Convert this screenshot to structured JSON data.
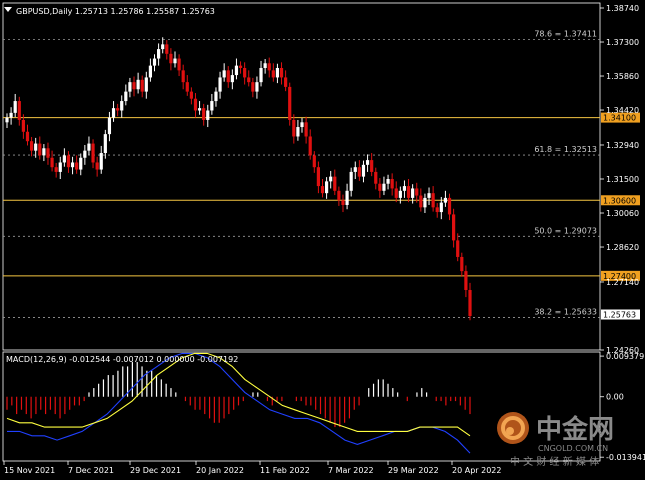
{
  "header": {
    "symbol_line": "GBPUSD,Daily  1.25713 1.25786 1.25587 1.25763",
    "dropdown_icon": "triangle-down-icon"
  },
  "indicator": {
    "label": "MACD(12,26,9) -0.012544 -0.007012 0.000000 -0.007192",
    "axis_ticks": [
      "0.009379",
      "0.00",
      "-0.013941"
    ]
  },
  "watermark": {
    "brand": "中金网",
    "domain": "CNGOLD.COM.CN",
    "tagline": "中 文 财 经 新 媒 体",
    "logo_icon": "cngold-logo-icon"
  },
  "colors": {
    "background": "#000000",
    "bull": "#ffffff",
    "bear": "#e01010",
    "level_line": "#f5c542",
    "fib_line": "#9a9a9a",
    "level_label_bg": "#f0a020",
    "current_label_bg": "#ffffff",
    "macd_main": "#2040ff",
    "macd_signal": "#ffff40"
  },
  "chart_data": {
    "type": "candlestick",
    "symbol": "GBPUSD",
    "timeframe": "Daily",
    "ohlc": {
      "open": 1.25713,
      "high": 1.25786,
      "low": 1.25587,
      "close": 1.25763
    },
    "ylim": [
      1.2426,
      1.3874
    ],
    "y_ticks": [
      "1.38740",
      "1.37300",
      "1.35860",
      "1.34420",
      "1.32940",
      "1.31500",
      "1.30060",
      "1.28620",
      "1.27140",
      "1.24260"
    ],
    "x_ticks": [
      "15 Nov 2021",
      "7 Dec 2021",
      "29 Dec 2021",
      "20 Jan 2022",
      "11 Feb 2022",
      "7 Mar 2022",
      "29 Mar 2022",
      "20 Apr 2022"
    ],
    "current_price": "1.25763",
    "levels": [
      {
        "value": 1.341,
        "label": "1.34100"
      },
      {
        "value": 1.306,
        "label": "1.30600"
      },
      {
        "value": 1.274,
        "label": "1.27400"
      }
    ],
    "fib_levels": [
      {
        "value": 1.37411,
        "label": "78.6 = 1.37411"
      },
      {
        "value": 1.32513,
        "label": "61.8 = 1.32513"
      },
      {
        "value": 1.29073,
        "label": "50.0 = 1.29073"
      },
      {
        "value": 1.25633,
        "label": "38.2 = 1.25633"
      }
    ],
    "closes": [
      1.341,
      1.343,
      1.348,
      1.34,
      1.335,
      1.331,
      1.327,
      1.33,
      1.325,
      1.328,
      1.324,
      1.32,
      1.318,
      1.322,
      1.325,
      1.32,
      1.322,
      1.319,
      1.324,
      1.327,
      1.33,
      1.322,
      1.319,
      1.326,
      1.334,
      1.341,
      1.345,
      1.344,
      1.348,
      1.352,
      1.356,
      1.353,
      1.357,
      1.352,
      1.358,
      1.363,
      1.366,
      1.37,
      1.372,
      1.368,
      1.364,
      1.366,
      1.361,
      1.356,
      1.352,
      1.349,
      1.344,
      1.345,
      1.34,
      1.344,
      1.348,
      1.352,
      1.358,
      1.361,
      1.356,
      1.359,
      1.363,
      1.362,
      1.358,
      1.356,
      1.352,
      1.356,
      1.362,
      1.364,
      1.361,
      1.358,
      1.362,
      1.358,
      1.354,
      1.34,
      1.333,
      1.337,
      1.339,
      1.333,
      1.325,
      1.32,
      1.312,
      1.309,
      1.314,
      1.316,
      1.31,
      1.306,
      1.304,
      1.31,
      1.318,
      1.32,
      1.316,
      1.321,
      1.323,
      1.318,
      1.313,
      1.31,
      1.313,
      1.315,
      1.311,
      1.307,
      1.31,
      1.312,
      1.307,
      1.311,
      1.308,
      1.303,
      1.307,
      1.309,
      1.303,
      1.301,
      1.305,
      1.307,
      1.3,
      1.289,
      1.282,
      1.276,
      1.268,
      1.257
    ]
  },
  "macd_data": {
    "histogram": [
      -0.003,
      -0.002,
      -0.004,
      -0.003,
      -0.004,
      -0.005,
      -0.004,
      -0.003,
      -0.004,
      -0.003,
      -0.004,
      -0.005,
      -0.004,
      -0.003,
      -0.002,
      -0.002,
      -0.001,
      0.001,
      0.002,
      0.003,
      0.004,
      0.005,
      0.005,
      0.006,
      0.007,
      0.007,
      0.008,
      0.008,
      0.007,
      0.006,
      0.006,
      0.005,
      0.004,
      0.003,
      0.002,
      0.001,
      0.0,
      -0.001,
      -0.002,
      -0.003,
      -0.003,
      -0.004,
      -0.005,
      -0.006,
      -0.006,
      -0.005,
      -0.004,
      -0.003,
      -0.002,
      -0.001,
      0.0,
      0.001,
      0.001,
      0.0,
      -0.001,
      -0.002,
      -0.001,
      -0.001,
      0.0,
      0.0,
      -0.001,
      -0.001,
      -0.002,
      -0.002,
      -0.003,
      -0.004,
      -0.005,
      -0.006,
      -0.007,
      -0.007,
      -0.006,
      -0.005,
      -0.003,
      -0.002,
      0.0,
      0.002,
      0.003,
      0.004,
      0.004,
      0.003,
      0.002,
      0.001,
      0.0,
      -0.001,
      0.0,
      0.001,
      0.002,
      0.001,
      0.0,
      -0.001,
      -0.001,
      -0.002,
      -0.001,
      -0.001,
      -0.002,
      -0.003,
      -0.004
    ],
    "main": [
      -0.008,
      -0.008,
      -0.009,
      -0.009,
      -0.01,
      -0.009,
      -0.008,
      -0.006,
      -0.004,
      -0.001,
      0.002,
      0.005,
      0.007,
      0.009,
      0.01,
      0.01,
      0.009,
      0.007,
      0.004,
      0.001,
      -0.001,
      -0.003,
      -0.004,
      -0.005,
      -0.005,
      -0.006,
      -0.008,
      -0.01,
      -0.011,
      -0.01,
      -0.009,
      -0.008,
      -0.008,
      -0.007,
      -0.007,
      -0.008,
      -0.01,
      -0.013
    ],
    "signal": [
      -0.005,
      -0.006,
      -0.006,
      -0.007,
      -0.007,
      -0.007,
      -0.007,
      -0.006,
      -0.005,
      -0.003,
      -0.001,
      0.002,
      0.005,
      0.007,
      0.009,
      0.01,
      0.01,
      0.009,
      0.007,
      0.004,
      0.002,
      0.0,
      -0.002,
      -0.003,
      -0.004,
      -0.005,
      -0.006,
      -0.007,
      -0.008,
      -0.008,
      -0.008,
      -0.008,
      -0.008,
      -0.007,
      -0.007,
      -0.007,
      -0.007,
      -0.009
    ]
  }
}
